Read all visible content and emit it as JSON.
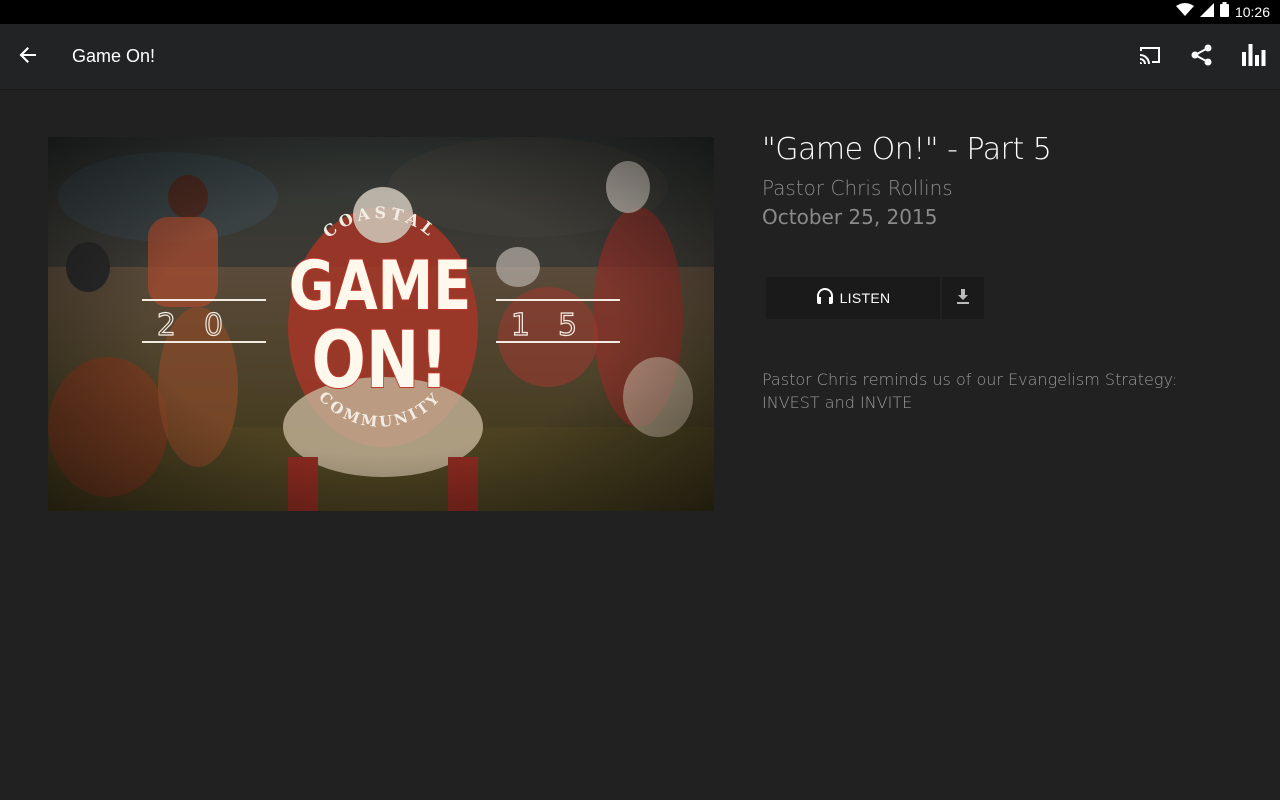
{
  "status_bar": {
    "time": "10:26",
    "icons": [
      "wifi-icon",
      "signal-icon",
      "battery-icon"
    ]
  },
  "app_bar": {
    "title": "Game On!",
    "back_icon": "arrow-back-icon",
    "actions": [
      "cast-icon",
      "share-icon",
      "stats-icon"
    ]
  },
  "artwork": {
    "top_arc_text": "COASTAL",
    "main_line1": "GAME",
    "main_line2": "ON!",
    "year_left": "20",
    "year_right": "15",
    "bottom_arc_text": "COMMUNITY"
  },
  "episode": {
    "title": "\"Game On!\" - Part 5",
    "speaker": "Pastor Chris Rollins",
    "date": "October 25, 2015",
    "description": "Pastor Chris reminds us of our Evangelism Strategy: INVEST and INVITE"
  },
  "buttons": {
    "listen_label": "LISTEN",
    "listen_icon": "headphones-icon",
    "download_icon": "download-icon"
  },
  "colors": {
    "background": "#212121",
    "app_bar": "#222324",
    "status_bar": "#000000",
    "button_bg": "#1a1a1a",
    "muted_text": "#8a8a8a"
  }
}
